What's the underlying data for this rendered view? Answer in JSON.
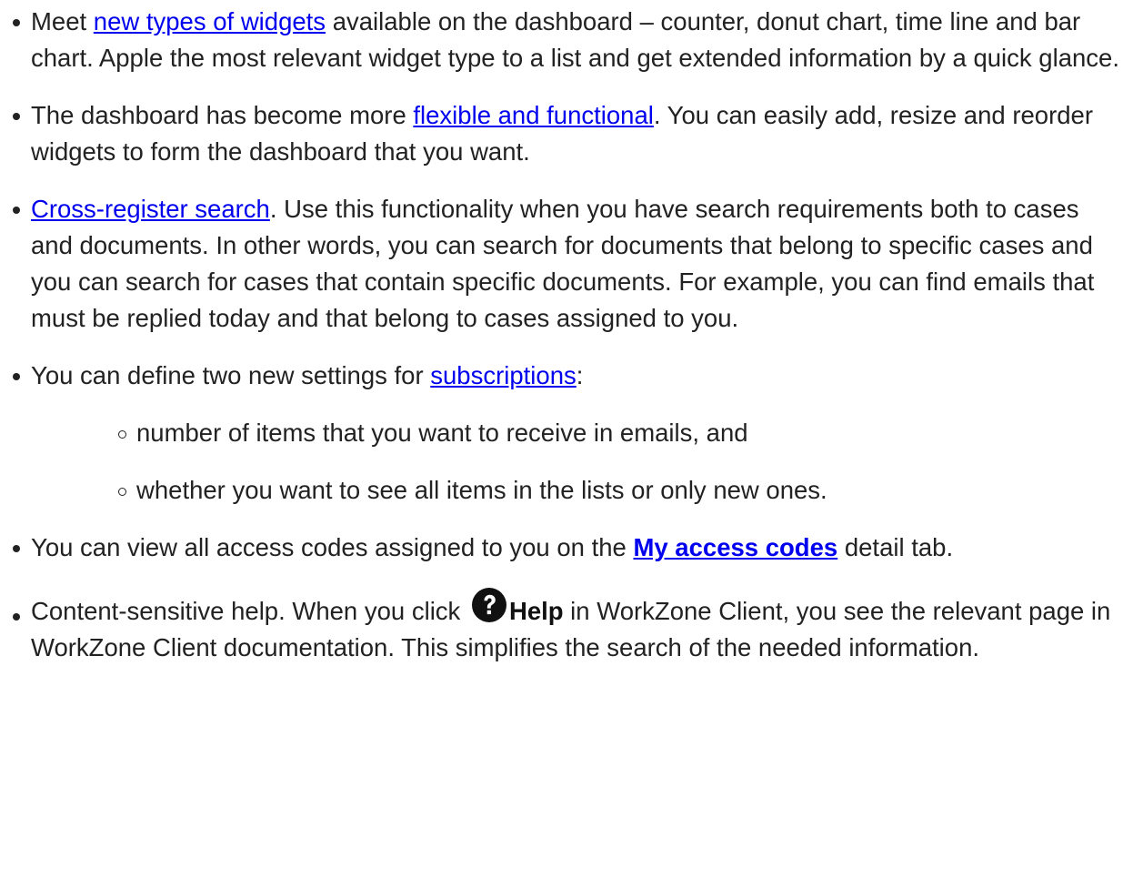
{
  "items": [
    {
      "pre": "Meet ",
      "link": "new types of widgets",
      "post": " available on the dashboard – counter, donut chart, time line and bar chart. Apple the most relevant widget type to a list and get extended information by a quick glance."
    },
    {
      "pre": "The dashboard has become more ",
      "link": "flexible and functional",
      "post": ". You can easily add, resize and reorder widgets to form the dashboard that you want."
    },
    {
      "pre": "",
      "link": "Cross-register search",
      "post": ". Use this functionality when you have search requirements both to cases and documents. In other words, you can search for documents that belong to specific cases and you can search for cases that contain specific doc­uments. For example, you can find emails that must be replied today and that belong to cases assigned to you."
    },
    {
      "pre": "You can define two new settings for ",
      "link": "subscriptions",
      "post": ":"
    },
    {
      "pre": "You can view all access codes assigned to you on the ",
      "link": "My access codes",
      "post": " detail tab."
    },
    {
      "pre": "Content-sensitive help. When you click ",
      "bold": "Help",
      "post": " in WorkZone Client, you see the relevant page in WorkZone Client documentation. This simplifies the search of the needed information."
    }
  ],
  "sub_items": [
    "number of items that you want to receive in emails, and",
    "whether you want to see all items in the lists or only new ones."
  ],
  "colors": {
    "text": "#222222",
    "link": "#0000ee",
    "icon": "#111111"
  },
  "icons": {
    "help": "question-circle-icon"
  }
}
